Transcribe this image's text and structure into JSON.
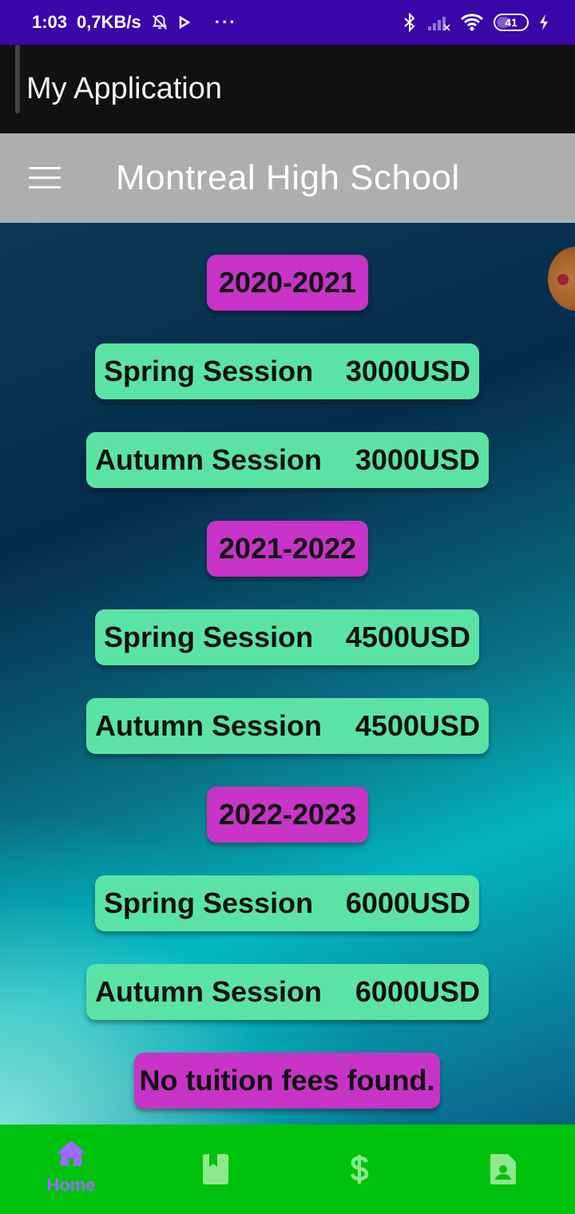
{
  "status_bar": {
    "time": "1:03",
    "net_speed": "0,7KB/s",
    "more": "···",
    "battery": "41",
    "icons": [
      "bell-off-icon",
      "play-icon",
      "bluetooth-icon",
      "signal-icon",
      "wifi-icon",
      "battery-icon",
      "charging-icon"
    ]
  },
  "app_bar": {
    "title": "My Application"
  },
  "toolbar": {
    "title": "Montreal High School",
    "menu_icon": "hamburger-menu-icon"
  },
  "fees": [
    {
      "year": "2020-2021",
      "sessions": [
        {
          "name": "Spring Session",
          "amount": "3000USD"
        },
        {
          "name": "Autumn Session",
          "amount": "3000USD"
        }
      ]
    },
    {
      "year": "2021-2022",
      "sessions": [
        {
          "name": "Spring Session",
          "amount": "4500USD"
        },
        {
          "name": "Autumn Session",
          "amount": "4500USD"
        }
      ]
    },
    {
      "year": "2022-2023",
      "sessions": [
        {
          "name": "Spring Session",
          "amount": "6000USD"
        },
        {
          "name": "Autumn Session",
          "amount": "6000USD"
        }
      ]
    }
  ],
  "empty_message": "No tuition fees found.",
  "bottom_nav": {
    "items": [
      {
        "label": "Home",
        "icon": "home-icon",
        "active": true
      },
      {
        "label": "",
        "icon": "book-icon",
        "active": false
      },
      {
        "label": "",
        "icon": "dollar-icon",
        "active": false
      },
      {
        "label": "",
        "icon": "contact-card-icon",
        "active": false
      }
    ],
    "active_color": "#9b6bff",
    "inactive_color": "#8ee88e",
    "background": "#00c20c"
  }
}
